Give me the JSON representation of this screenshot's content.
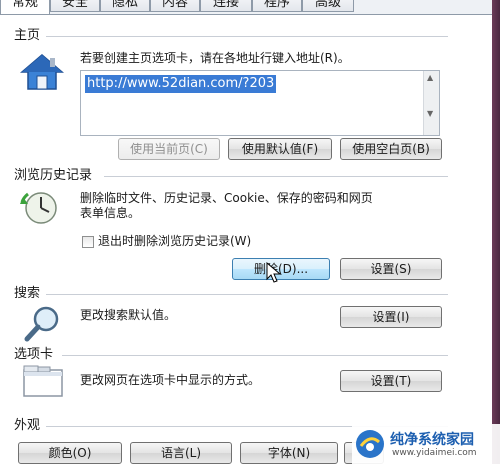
{
  "tabs": [
    "常规",
    "安全",
    "隐私",
    "内容",
    "连接",
    "程序",
    "高级"
  ],
  "homepage": {
    "title": "主页",
    "desc": "若要创建主页选项卡，请在各地址行键入地址(R)。",
    "url": "http://www.52dian.com/?203",
    "btn_current": "使用当前页(C)",
    "btn_default": "使用默认值(F)",
    "btn_blank": "使用空白页(B)"
  },
  "history": {
    "title": "浏览历史记录",
    "desc_line1": "删除临时文件、历史记录、Cookie、保存的密码和网页",
    "desc_line2": "表单信息。",
    "checkbox_label": "退出时删除浏览历史记录(W)",
    "btn_delete": "删除(D)...",
    "btn_settings": "设置(S)"
  },
  "search": {
    "title": "搜索",
    "desc": "更改搜索默认值。",
    "btn_settings": "设置(I)"
  },
  "tabs_section": {
    "title": "选项卡",
    "desc": "更改网页在选项卡中显示的方式。",
    "btn_settings": "设置(T)"
  },
  "appearance": {
    "title": "外观",
    "btn_colors": "颜色(O)",
    "btn_languages": "语言(L)",
    "btn_fonts": "字体(N)"
  },
  "watermark": {
    "name": "纯净系统家园",
    "url": "www.yidaimei.com"
  }
}
